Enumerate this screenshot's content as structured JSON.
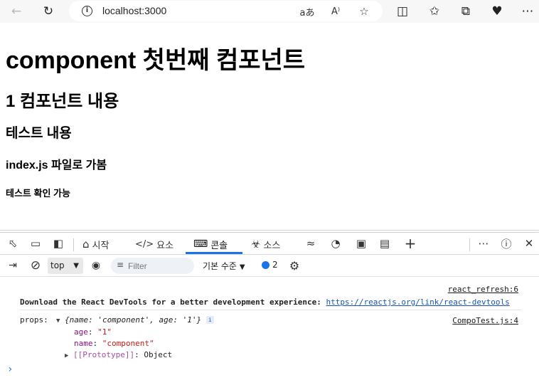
{
  "browser": {
    "url": "localhost:3000"
  },
  "page": {
    "h1": "component 첫번째 컴포넌트",
    "h2": "1 컴포넌트 내용",
    "h3": "테스트 내용",
    "h4": "index.js 파일로 가봄",
    "h5": "테스트 확인 가능"
  },
  "devtools": {
    "tabs": [
      {
        "label": "시작",
        "icon": "home-icon"
      },
      {
        "label": "요소",
        "icon": "code-icon"
      },
      {
        "label": "콘솔",
        "icon": "console-icon",
        "active": true
      },
      {
        "label": "소스",
        "icon": "bug-icon"
      }
    ],
    "context": "top",
    "filter_placeholder": "Filter",
    "levels": "기본 수준",
    "issues_count": "2",
    "accent_color": "#1a73e8"
  },
  "console": {
    "messages": [
      {
        "text": "Download the React DevTools for a better development experience: ",
        "link": "https://reactjs.org/link/react-devtools",
        "source": "react_refresh:6"
      },
      {
        "label": "props:",
        "summary": "{name: 'component', age: '1'}",
        "source": "CompoTest.js:4",
        "props": [
          {
            "key": "age",
            "value": "\"1\""
          },
          {
            "key": "name",
            "value": "\"component\""
          }
        ],
        "prototype_key": "[[Prototype]]",
        "prototype_value": "Object"
      }
    ]
  }
}
